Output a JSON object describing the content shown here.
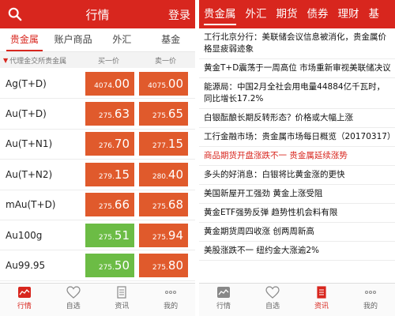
{
  "left": {
    "header": {
      "title": "行情",
      "login": "登录"
    },
    "tabs": [
      "贵金属",
      "账户商品",
      "外汇",
      "基金"
    ],
    "colhead": {
      "market": "代理金交所贵金属",
      "buy": "买一价",
      "sell": "卖一价"
    },
    "rows": [
      {
        "name": "Ag(T+D)",
        "buy_small": "4074.",
        "buy_big": "00",
        "sell_small": "4075.",
        "sell_big": "00",
        "buy_color": "red",
        "sell_color": "red"
      },
      {
        "name": "Au(T+D)",
        "buy_small": "275.",
        "buy_big": "63",
        "sell_small": "275.",
        "sell_big": "65",
        "buy_color": "red",
        "sell_color": "red"
      },
      {
        "name": "Au(T+N1)",
        "buy_small": "276.",
        "buy_big": "70",
        "sell_small": "277.",
        "sell_big": "15",
        "buy_color": "red",
        "sell_color": "red"
      },
      {
        "name": "Au(T+N2)",
        "buy_small": "279.",
        "buy_big": "15",
        "sell_small": "280.",
        "sell_big": "40",
        "buy_color": "red",
        "sell_color": "red"
      },
      {
        "name": "mAu(T+D)",
        "buy_small": "275.",
        "buy_big": "66",
        "sell_small": "275.",
        "sell_big": "68",
        "buy_color": "red",
        "sell_color": "red"
      },
      {
        "name": "Au100g",
        "buy_small": "275.",
        "buy_big": "51",
        "sell_small": "275.",
        "sell_big": "94",
        "buy_color": "green",
        "sell_color": "red"
      },
      {
        "name": "Au99.95",
        "buy_small": "275.",
        "buy_big": "50",
        "sell_small": "275.",
        "sell_big": "80",
        "buy_color": "green",
        "sell_color": "red"
      }
    ],
    "bottom_nav": [
      {
        "label": "行情",
        "icon": "market-icon",
        "active": true
      },
      {
        "label": "自选",
        "icon": "heart-icon",
        "active": false
      },
      {
        "label": "资讯",
        "icon": "document-icon",
        "active": false
      },
      {
        "label": "我的",
        "icon": "more-dots-icon",
        "active": false
      }
    ]
  },
  "right": {
    "tabs": [
      "贵金属",
      "外汇",
      "期货",
      "债券",
      "理财",
      "基"
    ],
    "news": [
      {
        "text": "工行北京分行：美联储会议信息被消化，贵金属价格显疲弱迹象",
        "highlight": false
      },
      {
        "text": "黄金T+D震荡于一周高位 市场重新审视美联储决议",
        "highlight": false
      },
      {
        "text": "能源局：中国2月全社会用电量44884亿千瓦时，同比增长17.2%",
        "highlight": false
      },
      {
        "text": "白银酝酿长期反转形态？价格或大幅上涨",
        "highlight": false
      },
      {
        "text": "工行金融市场：贵金属市场每日概览（20170317）",
        "highlight": false
      },
      {
        "text": "商品期货开盘涨跌不一 贵金属延续涨势",
        "highlight": true
      },
      {
        "text": "多头的好消息：白银将比黄金涨的更快",
        "highlight": false
      },
      {
        "text": "美国新屋开工强劲 黄金上涨受阻",
        "highlight": false
      },
      {
        "text": "黄金ETF强势反弹 趋势性机会料有限",
        "highlight": false
      },
      {
        "text": "黄金期货周四收涨 创两周新高",
        "highlight": false
      },
      {
        "text": "美股涨跌不一 纽约金大涨逾2%",
        "highlight": false
      }
    ],
    "bottom_nav": [
      {
        "label": "行情",
        "icon": "market-icon",
        "active": false
      },
      {
        "label": "自选",
        "icon": "heart-icon",
        "active": false
      },
      {
        "label": "资讯",
        "icon": "document-icon",
        "active": true
      },
      {
        "label": "我的",
        "icon": "more-dots-icon",
        "active": false
      }
    ]
  },
  "colors": {
    "brand_red": "#d8261e",
    "price_red": "#e05a2c",
    "price_green": "#6cbc45"
  }
}
